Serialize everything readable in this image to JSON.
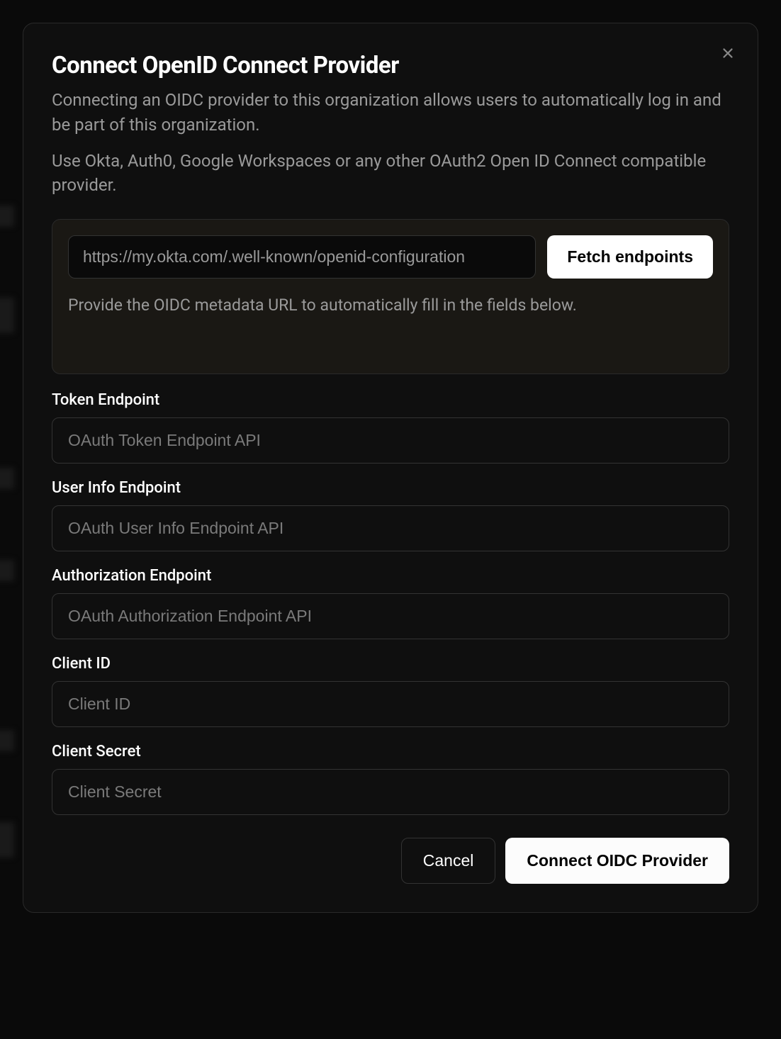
{
  "modal": {
    "title": "Connect OpenID Connect Provider",
    "description1": "Connecting an OIDC provider to this organization allows users to automatically log in and be part of this organization.",
    "description2": "Use Okta, Auth0, Google Workspaces or any other OAuth2 Open ID Connect compatible provider."
  },
  "metadata": {
    "url_placeholder": "https://my.okta.com/.well-known/openid-configuration",
    "fetch_label": "Fetch endpoints",
    "hint": "Provide the OIDC metadata URL to automatically fill in the fields below."
  },
  "fields": {
    "token_endpoint": {
      "label": "Token Endpoint",
      "placeholder": "OAuth Token Endpoint API"
    },
    "user_info_endpoint": {
      "label": "User Info Endpoint",
      "placeholder": "OAuth User Info Endpoint API"
    },
    "authorization_endpoint": {
      "label": "Authorization Endpoint",
      "placeholder": "OAuth Authorization Endpoint API"
    },
    "client_id": {
      "label": "Client ID",
      "placeholder": "Client ID"
    },
    "client_secret": {
      "label": "Client Secret",
      "placeholder": "Client Secret"
    }
  },
  "footer": {
    "cancel_label": "Cancel",
    "submit_label": "Connect OIDC Provider"
  }
}
